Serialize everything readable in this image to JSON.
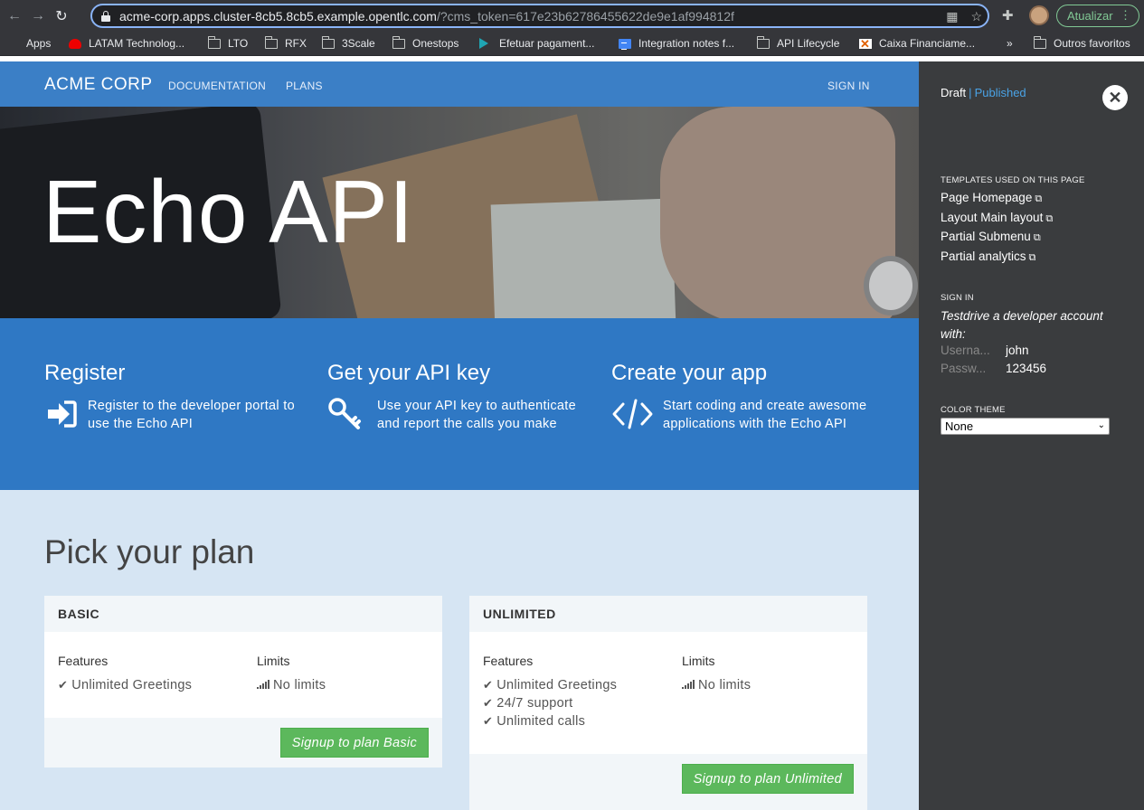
{
  "browser": {
    "url_host": "acme-corp.apps.cluster-8cb5.8cb5.example.opentlc.com",
    "url_rest": "/?cms_token=617e23b62786455622de9e1af994812f",
    "update_label": "Atualizar",
    "bookmarks": [
      {
        "label": "Apps",
        "icon": "apps-grid-icon"
      },
      {
        "label": "LATAM Technolog...",
        "icon": "redhat-icon"
      },
      {
        "label": "LTO",
        "icon": "folder-icon"
      },
      {
        "label": "RFX",
        "icon": "folder-icon"
      },
      {
        "label": "3Scale",
        "icon": "folder-icon"
      },
      {
        "label": "Onestops",
        "icon": "folder-icon"
      },
      {
        "label": "Efetuar pagament...",
        "icon": "play-icon"
      },
      {
        "label": "Integration notes f...",
        "icon": "doc-icon"
      },
      {
        "label": "API Lifecycle",
        "icon": "folder-icon"
      },
      {
        "label": "Caixa Financiame...",
        "icon": "caixa-icon"
      }
    ],
    "more_label": "»",
    "other_favorites": "Outros favoritos"
  },
  "navbar": {
    "brand": "ACME CORP",
    "links": [
      "DOCUMENTATION",
      "PLANS"
    ],
    "sign_in": "SIGN IN"
  },
  "hero": {
    "title": "Echo API"
  },
  "steps": [
    {
      "title": "Register",
      "text": "Register to the developer portal to use the Echo API",
      "icon": "sign-in-icon"
    },
    {
      "title": "Get your API key",
      "text": "Use your API key to authenticate and report the calls you make",
      "icon": "key-icon"
    },
    {
      "title": "Create your app",
      "text": "Start coding and create awesome applications with the Echo API",
      "icon": "code-icon"
    }
  ],
  "plans": {
    "heading": "Pick your plan",
    "features_label": "Features",
    "limits_label": "Limits",
    "items": [
      {
        "name": "BASIC",
        "features": [
          "Unlimited Greetings"
        ],
        "limits": [
          "No limits"
        ],
        "button": "Signup to plan Basic"
      },
      {
        "name": "UNLIMITED",
        "features": [
          "Unlimited Greetings",
          "24/7 support",
          "Unlimited calls"
        ],
        "limits": [
          "No limits"
        ],
        "button": "Signup to plan Unlimited"
      }
    ]
  },
  "cms": {
    "draft": "Draft",
    "separator": "|",
    "published": "Published",
    "templates_heading": "TEMPLATES USED ON THIS PAGE",
    "templates": [
      "Page Homepage",
      "Layout Main layout",
      "Partial Submenu",
      "Partial analytics"
    ],
    "signin_heading": "SIGN IN",
    "testdrive": "Testdrive a developer account with:",
    "username_label": "Userna...",
    "username": "john",
    "password_label": "Passw...",
    "password": "123456",
    "theme_heading": "COLOR THEME",
    "theme_value": "None"
  }
}
